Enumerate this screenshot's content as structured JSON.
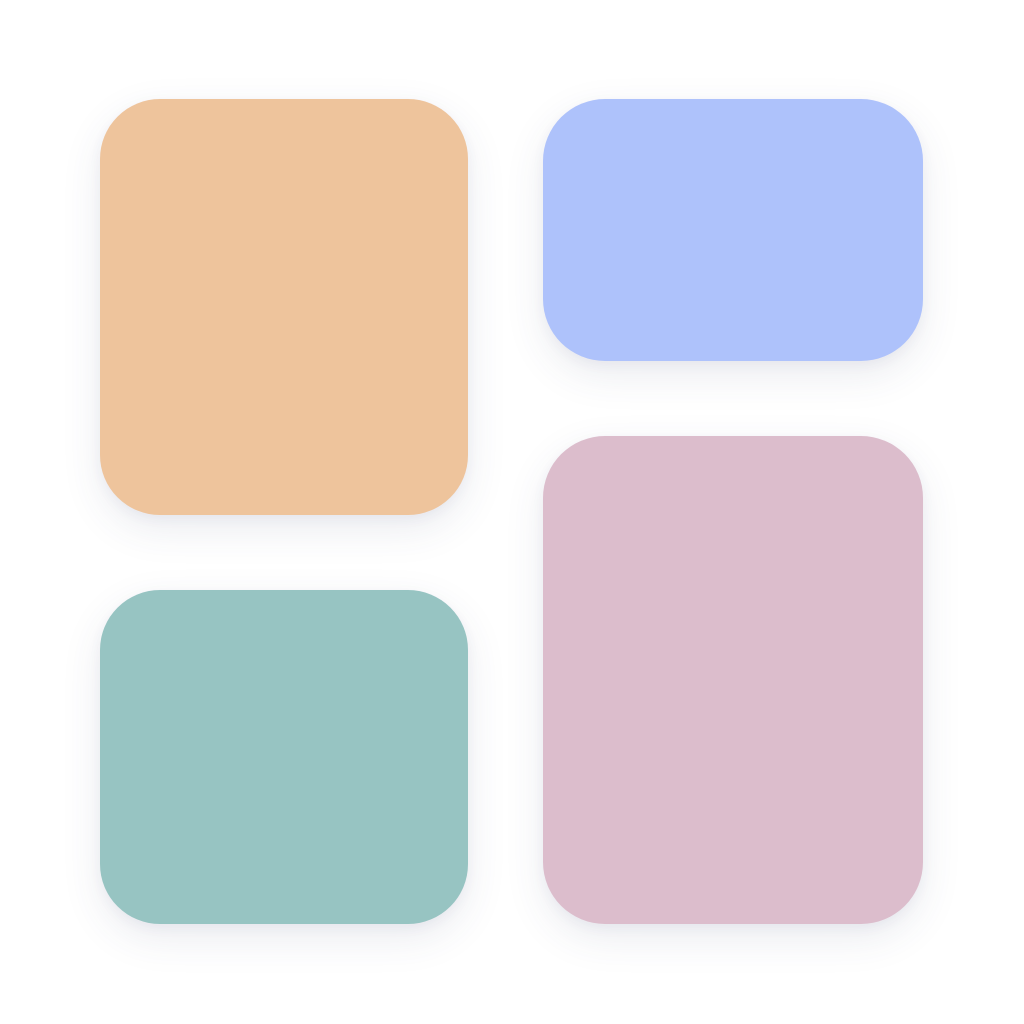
{
  "tiles": [
    {
      "id": "tile-top-left",
      "color": "#EEC49C"
    },
    {
      "id": "tile-top-right",
      "color": "#AEC2FB"
    },
    {
      "id": "tile-bottom-right",
      "color": "#DCBDCC"
    },
    {
      "id": "tile-bottom-left",
      "color": "#97C4C2"
    }
  ],
  "background": "#FFFFFF"
}
